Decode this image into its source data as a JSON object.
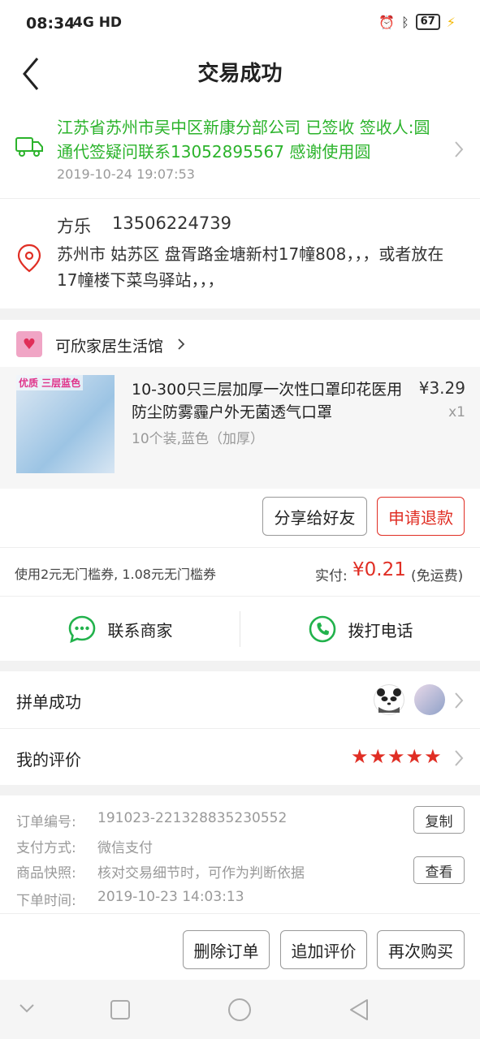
{
  "status_bar": {
    "time": "08:34",
    "network": "4G HD",
    "battery": "67"
  },
  "header": {
    "title": "交易成功"
  },
  "logistics": {
    "text": "江苏省苏州市吴中区新康分部公司 已签收 签收人:圆通代签疑问联系13052895567 感谢使用圆",
    "time": "2019-10-24 19:07:53"
  },
  "address": {
    "name": "方乐",
    "phone": "13506224739",
    "detail": "苏州市 姑苏区 盘胥路金塘新村17幢808，，，或者放在17幢楼下菜鸟驿站，，，"
  },
  "shop": {
    "name": "可欣家居生活馆"
  },
  "product": {
    "image_badge": "优质 三层蓝色",
    "title": "10-300只三层加厚一次性口罩印花医用防尘防雾霾户外无菌透气口罩",
    "sku": "10个装,蓝色（加厚）",
    "price": "¥3.29",
    "qty": "x1"
  },
  "actions": {
    "share": "分享给好友",
    "refund": "申请退款"
  },
  "payment": {
    "coupon": "使用2元无门槛券, 1.08元无门槛券",
    "paid_label": "实付:",
    "paid_amount": "¥0.21",
    "paid_note": "(免运费)"
  },
  "contact": {
    "merchant": "联系商家",
    "phone": "拨打电话"
  },
  "group": {
    "label": "拼单成功"
  },
  "review": {
    "label": "我的评价",
    "stars": "★★★★★"
  },
  "order_info": {
    "order_no_label": "订单编号:",
    "order_no": "191023-221328835230552",
    "pay_method_label": "支付方式:",
    "pay_method": "微信支付",
    "snapshot_label": "商品快照:",
    "snapshot": "核对交易细节时，可作为判断依据",
    "order_time_label": "下单时间:",
    "order_time": "2019-10-23 14:03:13",
    "copy_btn": "复制",
    "view_btn": "查看"
  },
  "bottom_actions": {
    "delete": "删除订单",
    "add_review": "追加评价",
    "rebuy": "再次购买"
  },
  "colors": {
    "accent_red": "#e02e24",
    "logistics_green": "#2bb32b",
    "wechat_green": "#22b24c"
  }
}
